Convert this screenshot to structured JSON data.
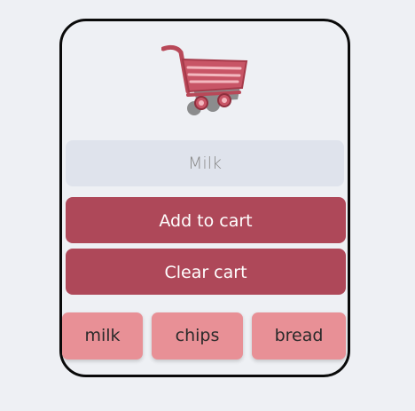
{
  "cart_icon": "shopping-cart-icon",
  "input": {
    "value": "",
    "placeholder": "Milk"
  },
  "buttons": {
    "add_label": "Add to cart",
    "clear_label": "Clear cart"
  },
  "items": [
    {
      "label": "milk"
    },
    {
      "label": "chips"
    },
    {
      "label": "bread"
    }
  ],
  "colors": {
    "accent": "#ae4859",
    "chip": "#e89096",
    "input_bg": "#dfe3ec",
    "page_bg": "#eef0f4"
  }
}
